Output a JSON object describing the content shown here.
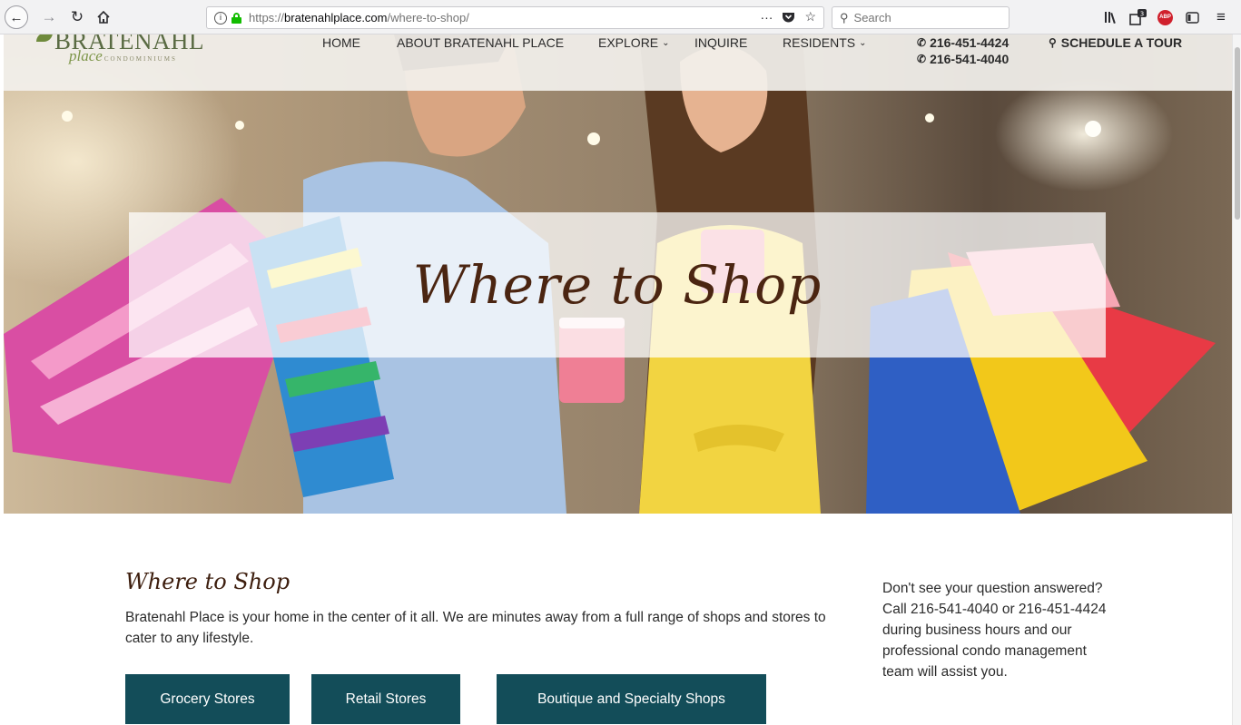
{
  "browser": {
    "url_prefix": "https://",
    "url_domain": "bratenahlplace.com",
    "url_path": "/where-to-shop/",
    "search_placeholder": "Search",
    "more_label": "···",
    "badge_count": "3"
  },
  "site": {
    "logo_main": "BRATENAHL",
    "logo_sub": "place",
    "logo_tag": "CONDOMINIUMS",
    "nav": [
      {
        "label": "HOME"
      },
      {
        "label": "ABOUT BRATENAHL PLACE"
      },
      {
        "label": "EXPLORE"
      },
      {
        "label": "INQUIRE"
      },
      {
        "label": "RESIDENTS"
      }
    ],
    "phones": [
      "216-451-4424",
      "216-541-4040"
    ],
    "tour_label": "SCHEDULE A TOUR"
  },
  "hero": {
    "title": "Where to Shop"
  },
  "content": {
    "title": "Where to Shop",
    "intro": "Bratenahl Place is your home in the center of it all. We are minutes away from a full range of shops and stores to cater to any lifestyle.",
    "buttons": [
      {
        "label": "Grocery Stores"
      },
      {
        "label": "Retail Stores"
      },
      {
        "label": "Boutique and Specialty Shops"
      }
    ],
    "aside": "Don't see your question answered? Call 216-541-4040 or 216-451-4424 during business hours and our professional condo management team will assist you."
  },
  "colors": {
    "accent": "#134d59",
    "heading": "#4b2511",
    "logo_green": "#5a6b43"
  }
}
